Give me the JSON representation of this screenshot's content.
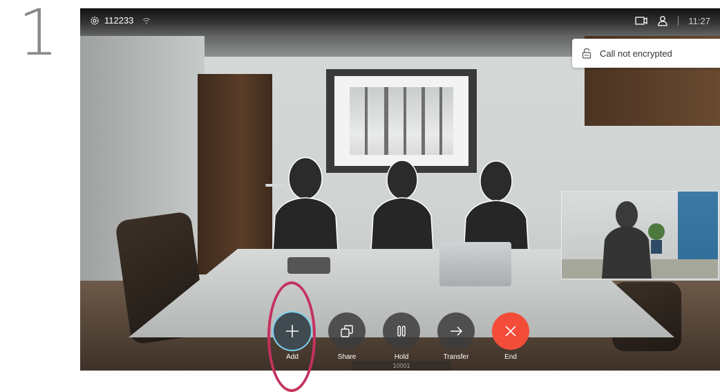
{
  "step": {
    "number": "1"
  },
  "top_bar": {
    "system_id": "112233",
    "time": "11:27",
    "icons": {
      "settings": "gear-icon",
      "wifi": "wifi-icon",
      "camera": "camera-icon",
      "user": "person-icon"
    }
  },
  "banner": {
    "text": "Call not encrypted",
    "icon": "lock-open-icon"
  },
  "call_controls": [
    {
      "id": "add",
      "label": "Add",
      "icon": "plus-icon",
      "highlighted": true
    },
    {
      "id": "share",
      "label": "Share",
      "icon": "share-icon"
    },
    {
      "id": "hold",
      "label": "Hold",
      "icon": "pause-icon"
    },
    {
      "id": "transfer",
      "label": "Transfer",
      "icon": "arrow-right-icon"
    },
    {
      "id": "end",
      "label": "End",
      "icon": "close-icon"
    }
  ],
  "strip_text": "10001",
  "colors": {
    "end": "#f34d3a",
    "add_ring": "#7fd3f2",
    "highlight": "#c4315d"
  }
}
